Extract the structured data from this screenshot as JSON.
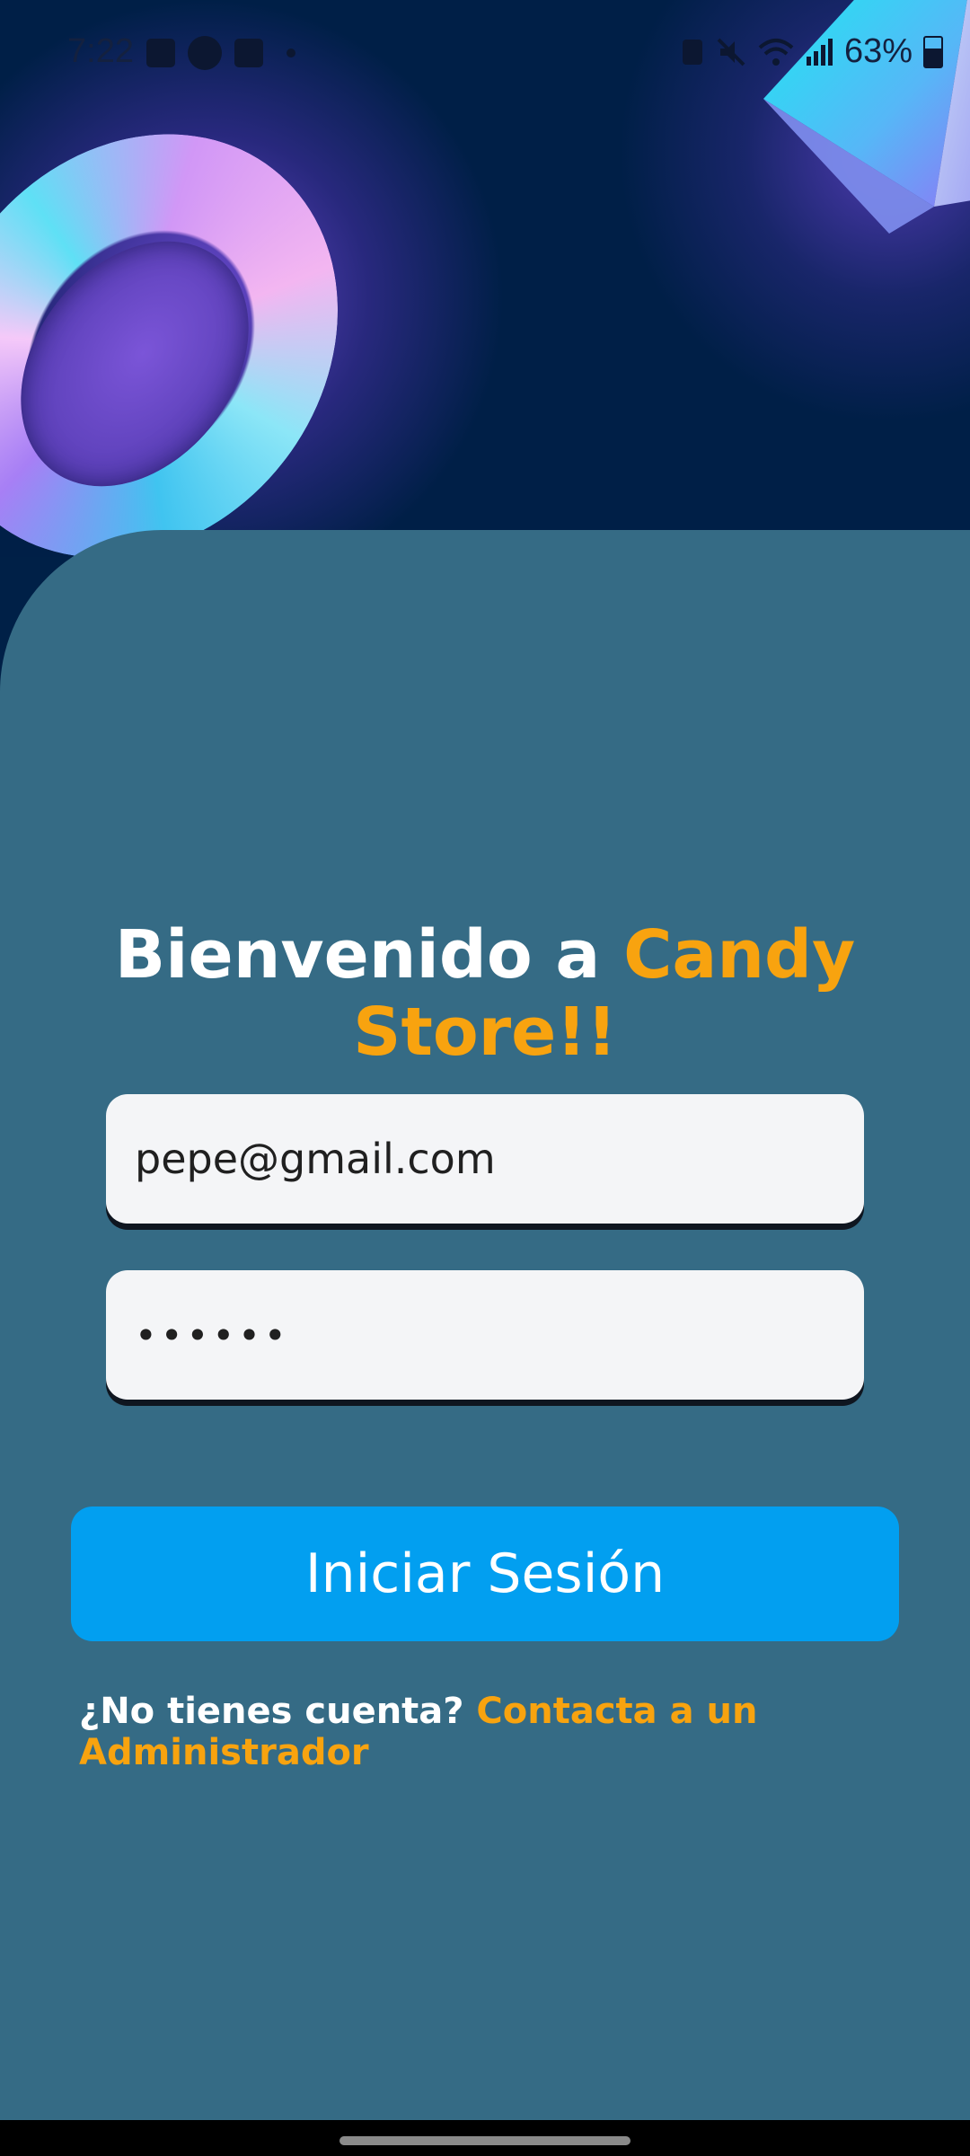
{
  "status_bar": {
    "time": "7:22",
    "battery_text": "63%",
    "left_icons": [
      "image-icon",
      "app-icon",
      "check-icon",
      "dot-icon"
    ],
    "right_icons": [
      "record-icon",
      "mute-icon",
      "wifi-icon",
      "signal-icon",
      "battery-icon"
    ]
  },
  "hero": {
    "decorations": [
      "ring-decoration",
      "crystal-decoration"
    ]
  },
  "welcome": {
    "prefix": "Bienvenido a ",
    "brand": "Candy Store!!"
  },
  "form": {
    "email_value": "pepe@gmail.com",
    "password_value": "••••••",
    "login_label": "Iniciar Sesión"
  },
  "footer": {
    "question": "¿No tienes cuenta? ",
    "link": "Contacta a un Administrador"
  },
  "colors": {
    "panel": "#356b85",
    "accent": "#f8a30f",
    "button": "#029ff0",
    "hero_bg": "#001f47"
  }
}
